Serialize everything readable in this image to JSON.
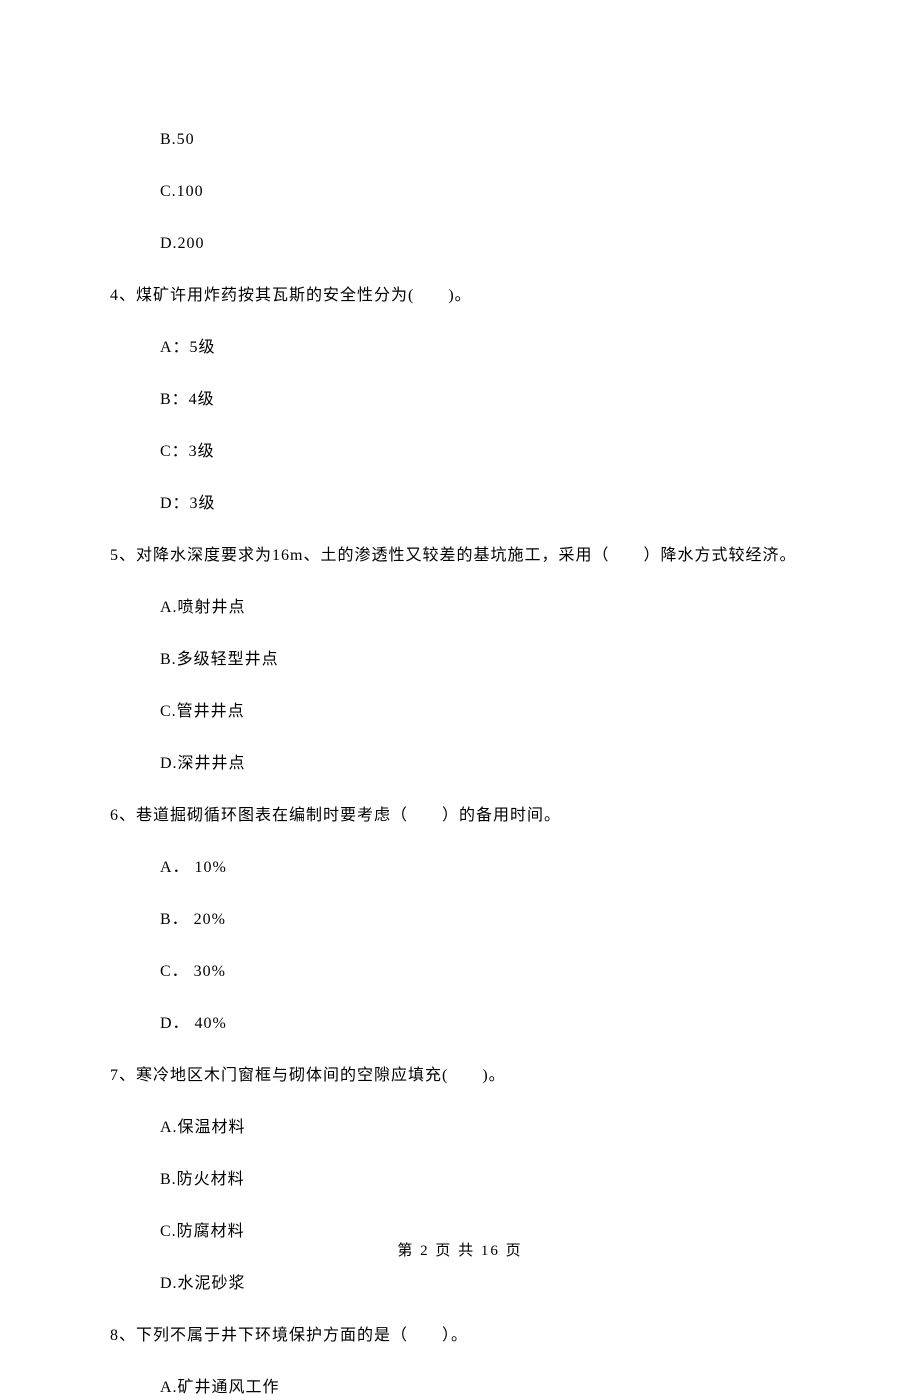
{
  "q3_opts": {
    "b": "B.50",
    "c": "C.100",
    "d": "D.200"
  },
  "q4": {
    "text": "4、煤矿许用炸药按其瓦斯的安全性分为(　　)。",
    "a": "A：5级",
    "b": "B：4级",
    "c": "C：3级",
    "d": "D：3级"
  },
  "q5": {
    "text": "5、对降水深度要求为16m、土的渗透性又较差的基坑施工，采用（　　）降水方式较经济。",
    "a": "A.喷射井点",
    "b": "B.多级轻型井点",
    "c": "C.管井井点",
    "d": "D.深井井点"
  },
  "q6": {
    "text": "6、巷道掘砌循环图表在编制时要考虑（　　）的备用时间。",
    "a": "A． 10%",
    "b": "B． 20%",
    "c": "C． 30%",
    "d": "D． 40%"
  },
  "q7": {
    "text": "7、寒冷地区木门窗框与砌体间的空隙应填充(　　)。",
    "a": "A.保温材料",
    "b": "B.防火材料",
    "c": "C.防腐材料",
    "d": "D.水泥砂浆"
  },
  "q8": {
    "text": "8、下列不属于井下环境保护方面的是（　　）。",
    "a": "A.矿井通风工作"
  },
  "footer": "第 2 页 共 16 页"
}
